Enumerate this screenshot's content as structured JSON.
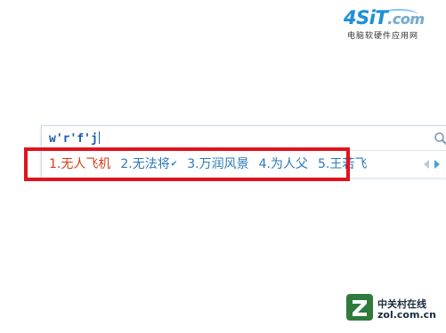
{
  "logo": {
    "mark_text": "4SiT",
    "mark_domain": ".com",
    "subtitle": "电脑软硬件应用网"
  },
  "ime": {
    "composition": "w'r'f'j",
    "candidates": [
      {
        "label": "1.无人飞机",
        "selected": true
      },
      {
        "label": "2.无法将",
        "badge": "✔"
      },
      {
        "label": "3.万润风景"
      },
      {
        "label": "4.为人父"
      },
      {
        "label": "5.王若飞"
      }
    ],
    "icons": {
      "search": "search-icon",
      "prev": "arrow-left-icon",
      "next": "arrow-right-icon"
    }
  },
  "watermark": {
    "cn": "中关村在线",
    "en": "zol.com.cn"
  },
  "colors": {
    "selected_candidate": "#d43d1a",
    "candidate": "#2a7ab8",
    "highlight_box": "#e0141e",
    "composition_text": "#1c5aa8"
  }
}
